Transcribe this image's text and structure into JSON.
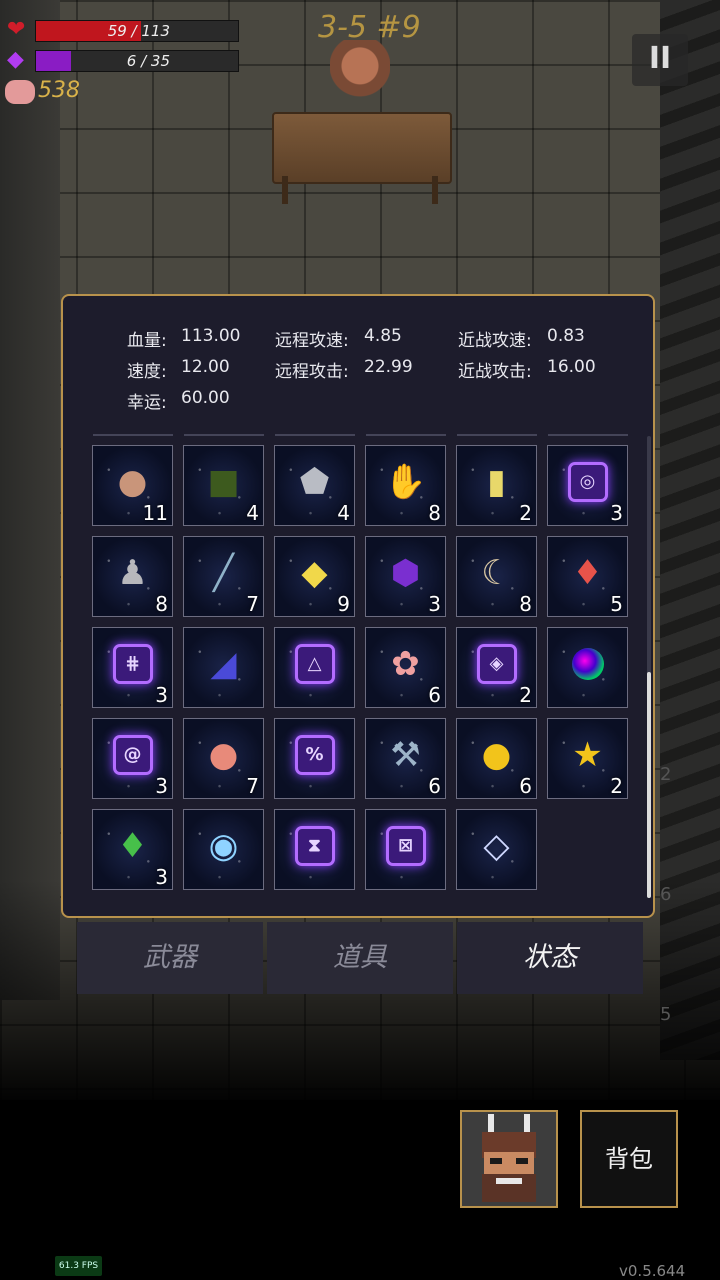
{
  "hud": {
    "hp_text": "59 / 113",
    "hp_fraction": 0.522,
    "mp_text": "6 / 35",
    "mp_fraction": 0.171,
    "coins": "538",
    "level": "3-5 #9",
    "hp_color": "#c0161e",
    "mp_color": "#8a1cc4"
  },
  "stats": {
    "hp_label": "血量:",
    "hp_value": "113.00",
    "speed_label": "速度:",
    "speed_value": "12.00",
    "luck_label": "幸运:",
    "luck_value": "60.00",
    "ranged_speed_label": "远程攻速:",
    "ranged_speed_value": "4.85",
    "ranged_atk_label": "远程攻击:",
    "ranged_atk_value": "22.99",
    "melee_speed_label": "近战攻速:",
    "melee_speed_value": "0.83",
    "melee_atk_label": "近战攻击:",
    "melee_atk_value": "16.00"
  },
  "items": [
    {
      "icon": "pouch",
      "count": "11"
    },
    {
      "icon": "skull-book",
      "count": "4"
    },
    {
      "icon": "stone",
      "count": "4"
    },
    {
      "icon": "gloves",
      "count": "8"
    },
    {
      "icon": "hourglass-card",
      "count": "2"
    },
    {
      "icon": "rune-spiral",
      "count": "3"
    },
    {
      "icon": "cloak-statue",
      "count": "8"
    },
    {
      "icon": "vial",
      "count": "7"
    },
    {
      "icon": "yellow-gem",
      "count": "9"
    },
    {
      "icon": "purple-shell",
      "count": "3"
    },
    {
      "icon": "horn",
      "count": "8"
    },
    {
      "icon": "red-crystal",
      "count": "5"
    },
    {
      "icon": "rune-cross",
      "count": "3"
    },
    {
      "icon": "blue-book",
      "count": ""
    },
    {
      "icon": "rune-triangle",
      "count": ""
    },
    {
      "icon": "flowers",
      "count": "6"
    },
    {
      "icon": "rune-eye",
      "count": "2"
    },
    {
      "icon": "rainbow-orb",
      "count": ""
    },
    {
      "icon": "rune-swirl",
      "count": "3"
    },
    {
      "icon": "peach",
      "count": "7"
    },
    {
      "icon": "rune-percent",
      "count": ""
    },
    {
      "icon": "hammer",
      "count": "6"
    },
    {
      "icon": "gold-coin",
      "count": "6"
    },
    {
      "icon": "star-trophy",
      "count": "2"
    },
    {
      "icon": "green-crystal",
      "count": "3"
    },
    {
      "icon": "glass-orb",
      "count": ""
    },
    {
      "icon": "rune-hourglass",
      "count": ""
    },
    {
      "icon": "rune-x",
      "count": ""
    },
    {
      "icon": "diamond-frame",
      "count": ""
    }
  ],
  "tabs": {
    "weapons": "武器",
    "props": "道具",
    "status": "状态"
  },
  "bag_label": "背包",
  "fps": "61.3 FPS",
  "version": "v0.5.644",
  "pause_symbol": "II",
  "ghost_numbers": [
    "2",
    "6",
    "5"
  ]
}
